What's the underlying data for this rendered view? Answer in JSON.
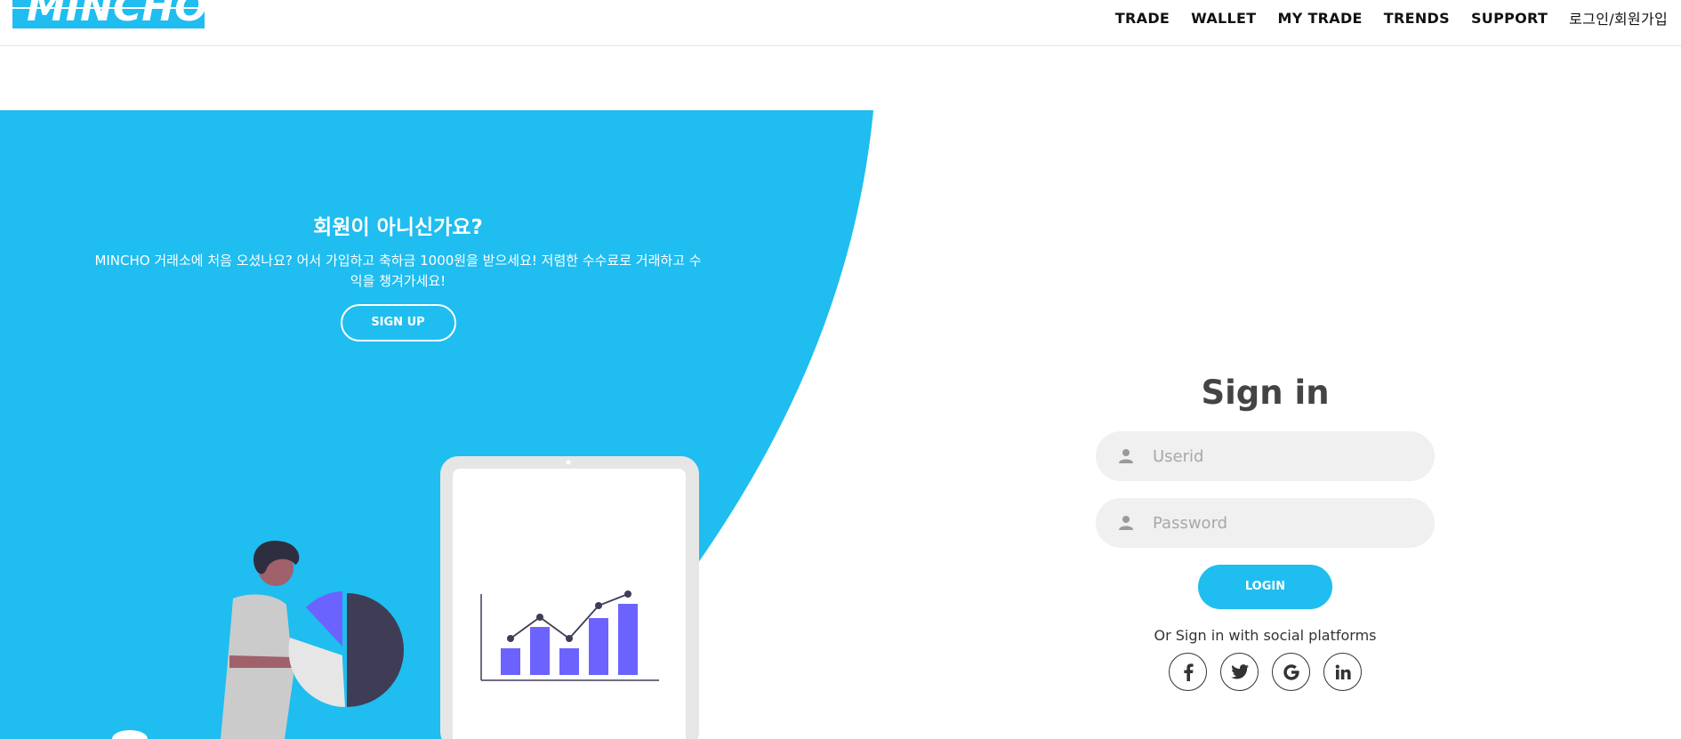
{
  "brand": {
    "logo_text": "MINCHO",
    "accent_color": "#1fbdf0",
    "chart_color": "#6c63ff",
    "dark_color": "#3f3d56"
  },
  "nav": {
    "items": [
      {
        "label": "TRADE"
      },
      {
        "label": "WALLET"
      },
      {
        "label": "MY TRADE"
      },
      {
        "label": "TRENDS"
      },
      {
        "label": "SUPPORT"
      },
      {
        "label": "로그인/회원가입"
      }
    ]
  },
  "promo": {
    "title": "회원이 아니신가요?",
    "text": "MINCHO 거래소에 처음 오셨나요? 어서 가입하고 축하금 1000원을 받으세요! 저렴한 수수료로 거래하고 수익을 챙겨가세요!",
    "signup_label": "SIGN UP"
  },
  "signin": {
    "title": "Sign in",
    "userid_placeholder": "Userid",
    "password_placeholder": "Password",
    "user_icon": "user-icon",
    "login_label": "LOGIN",
    "social_text": "Or Sign in with social platforms",
    "socials": [
      {
        "icon": "facebook-icon",
        "glyph": "f"
      },
      {
        "icon": "twitter-icon",
        "glyph": "🐦"
      },
      {
        "icon": "google-icon",
        "glyph": "G"
      },
      {
        "icon": "linkedin-icon",
        "glyph": "in"
      }
    ]
  }
}
